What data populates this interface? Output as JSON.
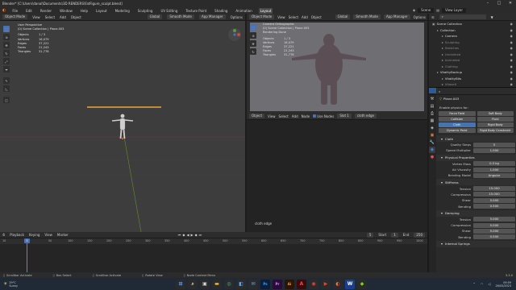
{
  "window": {
    "title": "Blender* [C:\\Users\\danal\\Documents\\3D RENDERS\\FatFigure_sculpt.blend]"
  },
  "menubar": {
    "tabs": [
      "File",
      "Edit",
      "Render",
      "Window",
      "Help",
      "Layout",
      "Modeling",
      "Sculpting",
      "UV Editing",
      "Texture Paint",
      "Shading",
      "Animation",
      "Layout"
    ],
    "active_tab_index": 12,
    "scene": "Scene",
    "view_layer": "View Layer"
  },
  "viewport": {
    "mode": "Object Mode",
    "menus": [
      "View",
      "Select",
      "Add",
      "Object"
    ],
    "transform": "Global",
    "snap": "Smooth Mode",
    "mirror": "App Manager",
    "options": "Options",
    "overlay": [
      "User Perspective",
      "(0) Scene Collection | Plane.003"
    ],
    "stats": [
      [
        "Objects",
        "1 / 3"
      ],
      [
        "Vertices",
        "16,079"
      ],
      [
        "Edges",
        "37,221"
      ],
      [
        "Faces",
        "21,243"
      ],
      [
        "Triangles",
        "31,778"
      ]
    ]
  },
  "camera_view": {
    "mode": "Object Mode",
    "menus": [
      "View",
      "Select",
      "Add",
      "Object"
    ],
    "transform": "Global",
    "snap": "Smooth Mode",
    "mirror": "App Manager",
    "options": "Options",
    "overlay": [
      "Camera Orthographic",
      "(0) Scene Collection | Plane.003",
      "Rendering Done"
    ],
    "stats": [
      [
        "Objects",
        "1 / 3"
      ],
      [
        "Vertices",
        "16,079"
      ],
      [
        "Edges",
        "37,221"
      ],
      [
        "Faces",
        "21,243"
      ],
      [
        "Triangles",
        "31,778"
      ]
    ]
  },
  "node_editor": {
    "mode": "Object",
    "menus": [
      "View",
      "Select",
      "Add",
      "Node"
    ],
    "use_nodes": "Use Nodes",
    "slot": "Slot 1",
    "material": "cloth edge",
    "label": "cloth edge"
  },
  "outliner": {
    "filter": "",
    "items": [
      {
        "label": "Scene Collection",
        "depth": 0,
        "color": "#dddddd"
      },
      {
        "label": "Collection",
        "depth": 1,
        "color": "#dddddd"
      },
      {
        "label": "Camera",
        "depth": 2,
        "color": "#dddddd"
      },
      {
        "label": "Sculpting",
        "depth": 2,
        "color": "#888888"
      },
      {
        "label": "Sketches",
        "depth": 2,
        "color": "#888888"
      },
      {
        "label": "Unclothed",
        "depth": 2,
        "color": "#888888"
      },
      {
        "label": "Animated",
        "depth": 2,
        "color": "#888888"
      },
      {
        "label": "Clothing",
        "depth": 2,
        "color": "#888888"
      },
      {
        "label": "VitalityBackup",
        "depth": 1,
        "color": "#dddddd"
      },
      {
        "label": "VitalityBits",
        "depth": 2,
        "color": "#dddddd"
      },
      {
        "label": "Vitaselt",
        "depth": 2,
        "color": "#888888"
      },
      {
        "label": "Plane.003",
        "depth": 1,
        "color": "#ffffff",
        "selected": true
      }
    ]
  },
  "properties": {
    "object": "Plane.003",
    "physics_heading": "Enable physics for:",
    "physics_buttons": [
      [
        "Force Field",
        "Soft Body"
      ],
      [
        "Collision",
        "Fluid"
      ],
      [
        "Cloth",
        "Rigid Body"
      ],
      [
        "Dynamic Paint",
        "Rigid Body Constraint"
      ]
    ],
    "sections": [
      {
        "title": "Cloth",
        "rows": [
          [
            "Quality Steps",
            "5"
          ],
          [
            "Speed Multiplier",
            "1.000"
          ]
        ]
      },
      {
        "title": "Physical Properties",
        "rows": [
          [
            "Vertex Mass",
            "0.3 kg"
          ],
          [
            "Air Viscosity",
            "1.000"
          ],
          [
            "Bending Model",
            "Angular"
          ]
        ]
      },
      {
        "title": "Stiffness",
        "rows": [
          [
            "Tension",
            "15.000"
          ],
          [
            "Compression",
            "15.000"
          ],
          [
            "Shear",
            "5.000"
          ],
          [
            "Bending",
            "0.500"
          ]
        ]
      },
      {
        "title": "Damping",
        "rows": [
          [
            "Tension",
            "5.000"
          ],
          [
            "Compression",
            "5.000"
          ],
          [
            "Shear",
            "5.000"
          ],
          [
            "Bending",
            "0.500"
          ]
        ]
      },
      {
        "title": "Internal Springs",
        "rows": []
      }
    ]
  },
  "timeline": {
    "menus": [
      "Playback",
      "Keying",
      "View",
      "Marker"
    ],
    "current_frame": "5",
    "start_label": "Start",
    "start": "1",
    "end_label": "End",
    "end": "250",
    "ruler": [
      "50",
      "100",
      "150",
      "200",
      "250",
      "300",
      "350",
      "400",
      "450",
      "500",
      "550",
      "600",
      "650",
      "700",
      "750",
      "800",
      "850",
      "900",
      "950",
      "1000"
    ],
    "ruler_left": [
      "10",
      "50"
    ]
  },
  "statusbar": {
    "items": [
      "Scrollbar Activate",
      "Box Select",
      "Scrollbar Activate",
      "Rotate View",
      "Node Context Menu"
    ],
    "version": "3.3.0"
  },
  "taskbar": {
    "weather_temp": "29°C",
    "weather_desc": "Sunny",
    "time": "09:59",
    "date": "26/05/2023",
    "apps": [
      {
        "icon": "start-icon",
        "glyph": "⊞",
        "bg": "#2b2b2b",
        "fg": "#4fa3ff"
      },
      {
        "icon": "search-icon",
        "glyph": "⌕",
        "bg": "#2b2b2b",
        "fg": "#dddddd"
      },
      {
        "icon": "task-view-icon",
        "glyph": "▣",
        "bg": "#2b2b2b",
        "fg": "#dddddd"
      },
      {
        "icon": "file-explorer-icon",
        "glyph": "▬",
        "bg": "#2b2b2b",
        "fg": "#f5c542"
      },
      {
        "icon": "edge-icon",
        "glyph": "◎",
        "bg": "#2b2b2b",
        "fg": "#36c3a8"
      },
      {
        "icon": "store-icon",
        "glyph": "◧",
        "bg": "#2b2b2b",
        "fg": "#5aa9f0"
      },
      {
        "icon": "mail-icon",
        "glyph": "✉",
        "bg": "#2b2b2b",
        "fg": "#5aa9f0"
      },
      {
        "icon": "photoshop-icon",
        "glyph": "Ps",
        "bg": "#0b1f3a",
        "fg": "#31a8ff"
      },
      {
        "icon": "premiere-icon",
        "glyph": "Pr",
        "bg": "#2a0b3a",
        "fg": "#d291ff"
      },
      {
        "icon": "illustrator-icon",
        "glyph": "Ai",
        "bg": "#2a1600",
        "fg": "#ff9a00"
      },
      {
        "icon": "acrobat-icon",
        "glyph": "A",
        "bg": "#3a0b0b",
        "fg": "#ff4040"
      },
      {
        "icon": "chrome-icon",
        "glyph": "◉",
        "bg": "#2b2b2b",
        "fg": "#e8453c"
      },
      {
        "icon": "media-icon",
        "glyph": "▶",
        "bg": "#2b2b2b",
        "fg": "#e04a2b"
      },
      {
        "icon": "blender-icon",
        "glyph": "◐",
        "bg": "#2b2b2b",
        "fg": "#f5792a"
      },
      {
        "icon": "word-icon",
        "glyph": "W",
        "bg": "#1b3f8a",
        "fg": "#ffffff"
      },
      {
        "icon": "app-icon",
        "glyph": "◆",
        "bg": "#2b2b2b",
        "fg": "#7ed321"
      }
    ]
  },
  "colors": {
    "accent": "#4a72b0",
    "selection_orange": "#f5a623",
    "active_blue": "#2f5a93"
  }
}
